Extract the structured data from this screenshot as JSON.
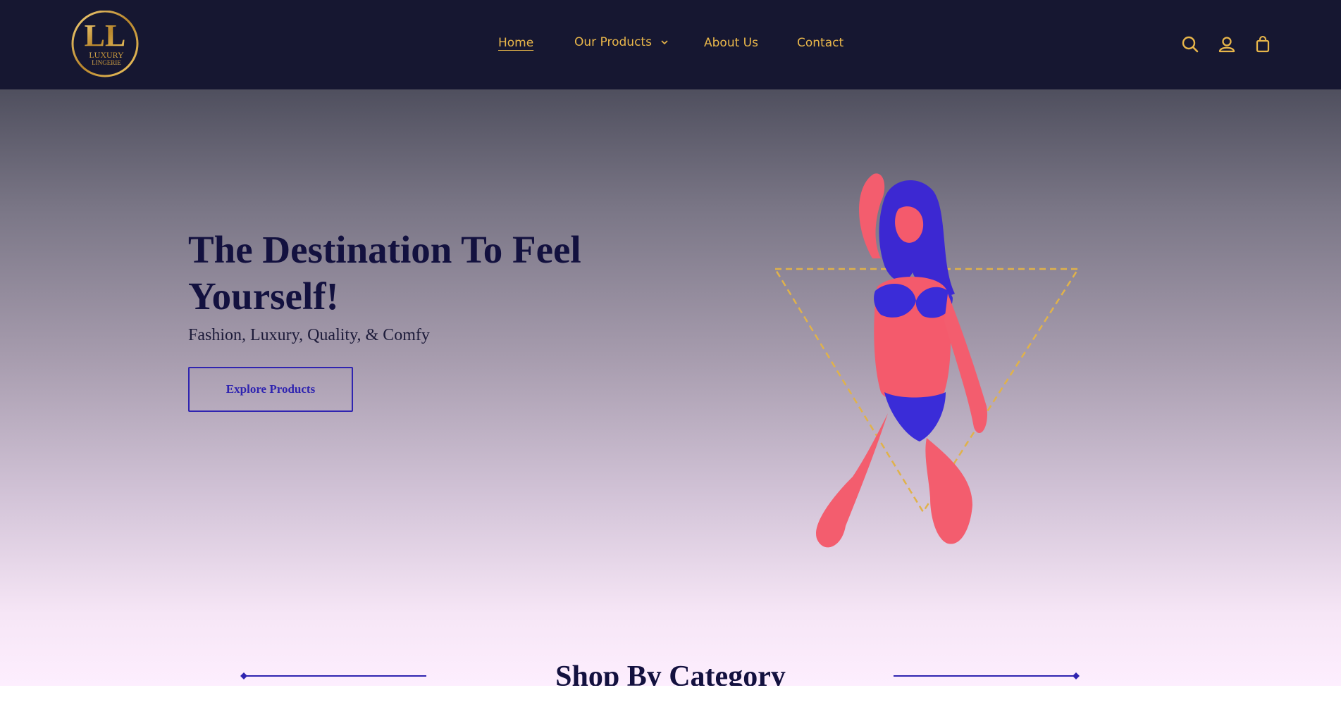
{
  "brand": {
    "line1": "LUXURY",
    "line2": "LINGERIE",
    "monogram": "LL"
  },
  "nav": {
    "home": "Home",
    "products": "Our Products",
    "about": "About Us",
    "contact": "Contact"
  },
  "icons": [
    "search-icon",
    "account-icon",
    "bag-icon",
    "chevron-down-icon"
  ],
  "hero": {
    "title": "The Destination To Feel Yourself!",
    "subtitle": "Fashion, Luxury, Quality, & Comfy",
    "cta": "Explore Products"
  },
  "section": {
    "title": "Shop By Category"
  },
  "colors": {
    "header_bg": "#161731",
    "accent_gold": "#e8b64a",
    "accent_blue": "#2f24b0",
    "title_navy": "#13113f"
  }
}
